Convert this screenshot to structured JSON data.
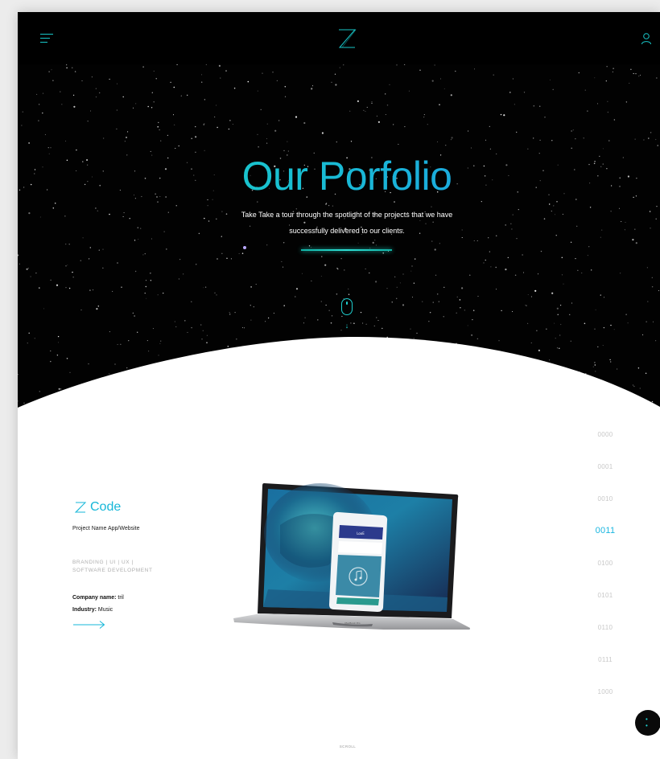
{
  "colors": {
    "accent": "#18c7c9",
    "accent_blue": "#1ab6e0",
    "hero_bg": "#020202",
    "page_bg": "#ffffff",
    "muted_text": "#c8c8c8"
  },
  "header": {
    "menu_icon": "hamburger-menu-icon",
    "logo_icon": "z-logo-icon",
    "user_icon": "user-account-icon"
  },
  "hero": {
    "title": "Our Porfolio",
    "subtitle_line1": "Take Take a tour through the spotlight of the projects that we have",
    "subtitle_line2": "successfully delivered to our clients.",
    "mouse_icon": "mouse-scroll-icon",
    "arrow_glyph": "↓"
  },
  "project": {
    "logo_text": "Code",
    "name": "Project Name App/Website",
    "tags_line1": "BRANDING  |  UI  |  UX  |",
    "tags_line2": "SOFTWARE DEVELOPMENT",
    "company_label": "Company name:",
    "company_value": "tril",
    "industry_label": "Industry:",
    "industry_value": "Music",
    "arrow_icon": "right-arrow-icon",
    "device_caption": "MacBook Pro",
    "phone_header": "LooE"
  },
  "binary_nav": {
    "items": [
      "0000",
      "0001",
      "0010",
      "0011",
      "0100",
      "0101",
      "0110",
      "0111",
      "1000"
    ],
    "active_index": 3
  },
  "footer": {
    "scroll_label": "SCROLL",
    "fab_icon": "fab-toggle-icon",
    "fab_dot": "•"
  }
}
